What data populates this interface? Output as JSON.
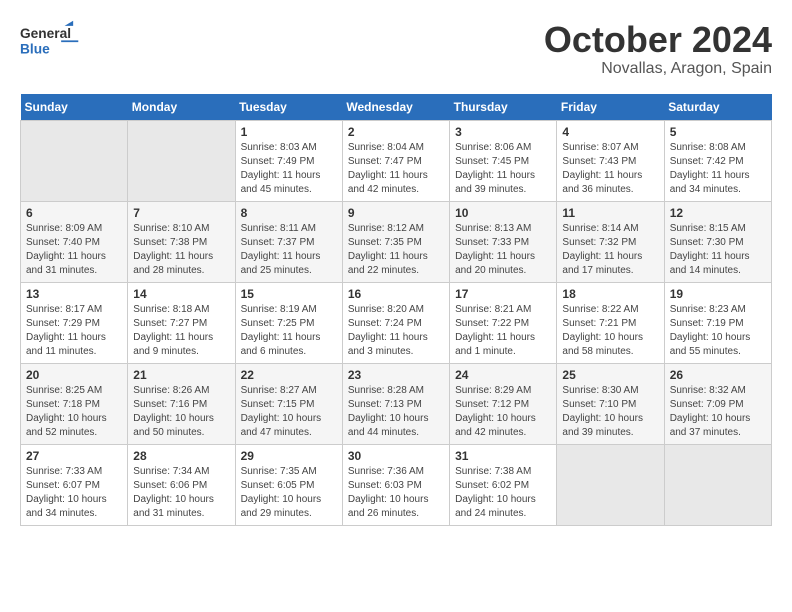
{
  "header": {
    "logo_general": "General",
    "logo_blue": "Blue",
    "month_title": "October 2024",
    "location": "Novallas, Aragon, Spain"
  },
  "weekdays": [
    "Sunday",
    "Monday",
    "Tuesday",
    "Wednesday",
    "Thursday",
    "Friday",
    "Saturday"
  ],
  "weeks": [
    [
      {
        "day": "",
        "empty": true
      },
      {
        "day": "",
        "empty": true
      },
      {
        "day": "1",
        "sunrise": "8:03 AM",
        "sunset": "7:49 PM",
        "daylight": "11 hours and 45 minutes."
      },
      {
        "day": "2",
        "sunrise": "8:04 AM",
        "sunset": "7:47 PM",
        "daylight": "11 hours and 42 minutes."
      },
      {
        "day": "3",
        "sunrise": "8:06 AM",
        "sunset": "7:45 PM",
        "daylight": "11 hours and 39 minutes."
      },
      {
        "day": "4",
        "sunrise": "8:07 AM",
        "sunset": "7:43 PM",
        "daylight": "11 hours and 36 minutes."
      },
      {
        "day": "5",
        "sunrise": "8:08 AM",
        "sunset": "7:42 PM",
        "daylight": "11 hours and 34 minutes."
      }
    ],
    [
      {
        "day": "6",
        "sunrise": "8:09 AM",
        "sunset": "7:40 PM",
        "daylight": "11 hours and 31 minutes."
      },
      {
        "day": "7",
        "sunrise": "8:10 AM",
        "sunset": "7:38 PM",
        "daylight": "11 hours and 28 minutes."
      },
      {
        "day": "8",
        "sunrise": "8:11 AM",
        "sunset": "7:37 PM",
        "daylight": "11 hours and 25 minutes."
      },
      {
        "day": "9",
        "sunrise": "8:12 AM",
        "sunset": "7:35 PM",
        "daylight": "11 hours and 22 minutes."
      },
      {
        "day": "10",
        "sunrise": "8:13 AM",
        "sunset": "7:33 PM",
        "daylight": "11 hours and 20 minutes."
      },
      {
        "day": "11",
        "sunrise": "8:14 AM",
        "sunset": "7:32 PM",
        "daylight": "11 hours and 17 minutes."
      },
      {
        "day": "12",
        "sunrise": "8:15 AM",
        "sunset": "7:30 PM",
        "daylight": "11 hours and 14 minutes."
      }
    ],
    [
      {
        "day": "13",
        "sunrise": "8:17 AM",
        "sunset": "7:29 PM",
        "daylight": "11 hours and 11 minutes."
      },
      {
        "day": "14",
        "sunrise": "8:18 AM",
        "sunset": "7:27 PM",
        "daylight": "11 hours and 9 minutes."
      },
      {
        "day": "15",
        "sunrise": "8:19 AM",
        "sunset": "7:25 PM",
        "daylight": "11 hours and 6 minutes."
      },
      {
        "day": "16",
        "sunrise": "8:20 AM",
        "sunset": "7:24 PM",
        "daylight": "11 hours and 3 minutes."
      },
      {
        "day": "17",
        "sunrise": "8:21 AM",
        "sunset": "7:22 PM",
        "daylight": "11 hours and 1 minute."
      },
      {
        "day": "18",
        "sunrise": "8:22 AM",
        "sunset": "7:21 PM",
        "daylight": "10 hours and 58 minutes."
      },
      {
        "day": "19",
        "sunrise": "8:23 AM",
        "sunset": "7:19 PM",
        "daylight": "10 hours and 55 minutes."
      }
    ],
    [
      {
        "day": "20",
        "sunrise": "8:25 AM",
        "sunset": "7:18 PM",
        "daylight": "10 hours and 52 minutes."
      },
      {
        "day": "21",
        "sunrise": "8:26 AM",
        "sunset": "7:16 PM",
        "daylight": "10 hours and 50 minutes."
      },
      {
        "day": "22",
        "sunrise": "8:27 AM",
        "sunset": "7:15 PM",
        "daylight": "10 hours and 47 minutes."
      },
      {
        "day": "23",
        "sunrise": "8:28 AM",
        "sunset": "7:13 PM",
        "daylight": "10 hours and 44 minutes."
      },
      {
        "day": "24",
        "sunrise": "8:29 AM",
        "sunset": "7:12 PM",
        "daylight": "10 hours and 42 minutes."
      },
      {
        "day": "25",
        "sunrise": "8:30 AM",
        "sunset": "7:10 PM",
        "daylight": "10 hours and 39 minutes."
      },
      {
        "day": "26",
        "sunrise": "8:32 AM",
        "sunset": "7:09 PM",
        "daylight": "10 hours and 37 minutes."
      }
    ],
    [
      {
        "day": "27",
        "sunrise": "7:33 AM",
        "sunset": "6:07 PM",
        "daylight": "10 hours and 34 minutes."
      },
      {
        "day": "28",
        "sunrise": "7:34 AM",
        "sunset": "6:06 PM",
        "daylight": "10 hours and 31 minutes."
      },
      {
        "day": "29",
        "sunrise": "7:35 AM",
        "sunset": "6:05 PM",
        "daylight": "10 hours and 29 minutes."
      },
      {
        "day": "30",
        "sunrise": "7:36 AM",
        "sunset": "6:03 PM",
        "daylight": "10 hours and 26 minutes."
      },
      {
        "day": "31",
        "sunrise": "7:38 AM",
        "sunset": "6:02 PM",
        "daylight": "10 hours and 24 minutes."
      },
      {
        "day": "",
        "empty": true
      },
      {
        "day": "",
        "empty": true
      }
    ]
  ],
  "labels": {
    "sunrise_prefix": "Sunrise: ",
    "sunset_prefix": "Sunset: ",
    "daylight_prefix": "Daylight: "
  }
}
